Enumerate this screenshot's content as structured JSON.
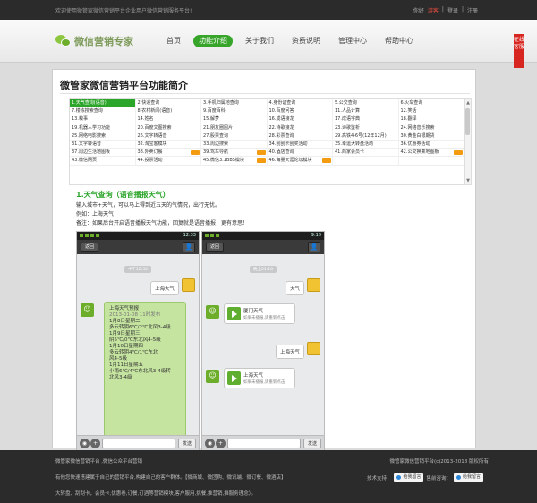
{
  "topbar": {
    "welcome": "欢迎使用微管家微信营销平台企业用户微信营销服务平台!",
    "greeting": "你好",
    "visitor": "游客",
    "login": "登录",
    "register": "注册"
  },
  "header": {
    "logo_text": "微信营销专家",
    "nav": [
      {
        "label": "首页"
      },
      {
        "label": "功能介绍"
      },
      {
        "label": "关于我们"
      },
      {
        "label": "资费说明"
      },
      {
        "label": "管理中心"
      },
      {
        "label": "帮助中心"
      }
    ]
  },
  "side_tab": "在线客服",
  "main": {
    "title": "微管家微信营销平台功能简介",
    "features": [
      [
        "1.天气查询(语音)",
        "2.快递查询",
        "3.手机归属地查询",
        "4.身份证查询",
        "5.公交查询",
        "6.火车查询"
      ],
      [
        "7.楼栋搜索查询",
        "8.农村新闻(语音)",
        "9.百度百科",
        "10.百度问答",
        "11.人品计算",
        "12.笑话"
      ],
      [
        "13.糗事",
        "14.姓名",
        "15.解梦",
        "16.成语接龙",
        "17.成语字典",
        "18.翻译"
      ],
      [
        "19.机器人学习功能",
        "20.百度文图搜索",
        "21.朋友圈图片",
        "22.诗歌接龙",
        "23.诗歌鉴析",
        "24.网络音乐搜索"
      ],
      [
        "25.网络电影搜索",
        "26.文字转语音",
        "27.股票查询",
        "28.彩票查询",
        "29.高铁4-6号(12年12月)",
        "30.黄金白银期货"
      ],
      [
        "31.文字转语音",
        "32.淘宝客模块",
        "33.周边搜索",
        "34.刮刮卡刮奖活动",
        "35.幸运大转盘活动",
        "36.优惠券活动"
      ],
      [
        "37.周边生活地图板",
        "38.外卖订餐",
        "39.驾车导航",
        "40.酒店查询",
        "41.商家会员卡",
        "42.公交换乘地图板"
      ],
      [
        "43.微信网页",
        "44.投票活动",
        "45.微信3.1BBS模块",
        "46.海量天涯论坛模块",
        "",
        ""
      ]
    ],
    "badges": [
      [
        6,
        2
      ],
      [
        6,
        5
      ],
      [
        7,
        2
      ],
      [
        7,
        3
      ],
      [
        6,
        1
      ]
    ],
    "detail": {
      "title": "1.天气查询（语音播报天气）",
      "line1": "输入城市+天气，可以马上得到近五天的气情况，出行无忧。",
      "line2": "例如：上海天气",
      "line3": "备注：如果后台开启语音播报天气功能，回复就是语音播报，更有意思！"
    },
    "phone_left": {
      "time": "12:33",
      "back": "返回",
      "timestamp": "中午12:32",
      "user_msg": "上海天气",
      "forecast": [
        "上海天气预报",
        "2013-01-08 11时发布",
        "",
        "1月8日星期二",
        "多云转阴6℃/2℃北风3-4级",
        "",
        "1月9日星期三",
        "阴5℃/0℃东北风4-5级",
        "",
        "1月10日星期四",
        "多云转阴4℃/1℃东北",
        "风4-5级",
        "",
        "1月11日星期五",
        "小雨6℃/4℃东北风3-4级转",
        "北风3-4级"
      ],
      "send": "发送"
    },
    "phone_right": {
      "time": "9:19",
      "back": "返回",
      "timestamp": "晚上21:18",
      "msg1": "天气",
      "card1_title": "厦门天气",
      "card1_sub": "如果未播报,请重新点击",
      "msg2": "上海天气",
      "card2_title": "上海天气",
      "card2_sub": "如果未播报,请重新点击",
      "send": "发送"
    }
  },
  "footer": {
    "line1": "微管家微信营销平台 ,微信公众平台营销",
    "line2": "有他您快速搭建属于自己的营销平台,构建自己的客户群体。【微商城、微团购、微讯端、微订餐、微酒店】",
    "line3": "大转盘、刮刮卡，会员卡,优惠卷,订餐,订酒等营销模块,客户服用,挑餐,推营销,推服务理念）。",
    "copyright": "微管家微信营销平台(c)2013-2018 版权所有",
    "tech_label": "技术支持：",
    "qq1": "给我留言",
    "presale_label": "售前咨询：",
    "qq2": "给我留言"
  }
}
